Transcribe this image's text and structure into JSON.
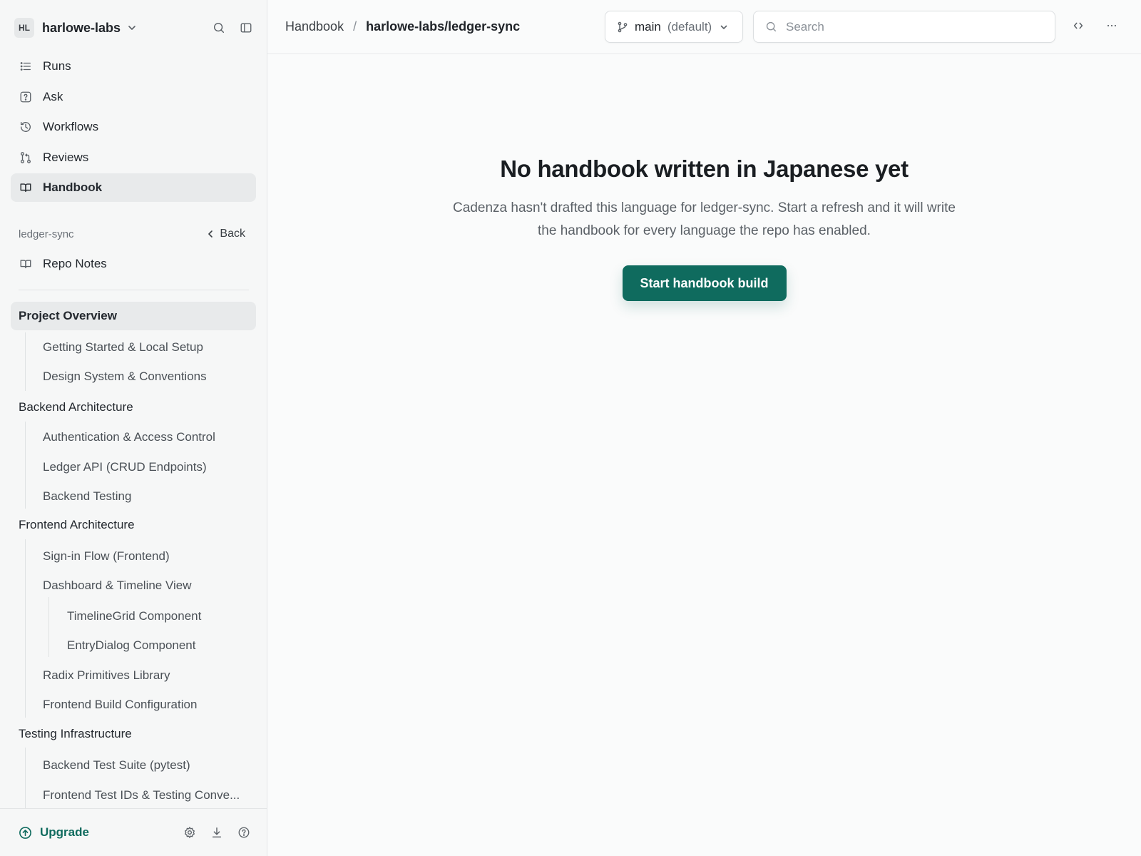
{
  "workspace": {
    "initials": "HL",
    "name": "harlowe-labs"
  },
  "nav": {
    "items": [
      {
        "label": "Runs",
        "icon": "list-icon"
      },
      {
        "label": "Ask",
        "icon": "question-icon"
      },
      {
        "label": "Workflows",
        "icon": "history-icon"
      },
      {
        "label": "Reviews",
        "icon": "pull-request-icon"
      },
      {
        "label": "Handbook",
        "icon": "book-icon",
        "active": true
      }
    ]
  },
  "repo": {
    "name": "ledger-sync",
    "back_label": "Back",
    "notes_label": "Repo Notes"
  },
  "toc": [
    {
      "label": "Project Overview",
      "level": 0,
      "active": true
    },
    {
      "label": "Getting Started & Local Setup",
      "level": 1
    },
    {
      "label": "Design System & Conventions",
      "level": 1
    },
    {
      "label": "Backend Architecture",
      "level": 0
    },
    {
      "label": "Authentication & Access Control",
      "level": 1
    },
    {
      "label": "Ledger API (CRUD Endpoints)",
      "level": 1
    },
    {
      "label": "Backend Testing",
      "level": 1
    },
    {
      "label": "Frontend Architecture",
      "level": 0
    },
    {
      "label": "Sign-in Flow (Frontend)",
      "level": 1
    },
    {
      "label": "Dashboard & Timeline View",
      "level": 1
    },
    {
      "label": "TimelineGrid Component",
      "level": 2
    },
    {
      "label": "EntryDialog Component",
      "level": 2
    },
    {
      "label": "Radix Primitives Library",
      "level": 1
    },
    {
      "label": "Frontend Build Configuration",
      "level": 1
    },
    {
      "label": "Testing Infrastructure",
      "level": 0
    },
    {
      "label": "Backend Test Suite (pytest)",
      "level": 1
    },
    {
      "label": "Frontend Test IDs & Testing Conve...",
      "level": 1
    }
  ],
  "footer": {
    "upgrade_label": "Upgrade"
  },
  "topbar": {
    "breadcrumb_root": "Handbook",
    "breadcrumb_sep": "/",
    "breadcrumb_current": "harlowe-labs/ledger-sync",
    "branch_name": "main",
    "branch_default": "(default)",
    "search_placeholder": "Search"
  },
  "empty_state": {
    "title": "No handbook written in Japanese yet",
    "description": "Cadenza hasn't drafted this language for ledger-sync. Start a refresh and it will write the handbook for every language the repo has enabled.",
    "button_label": "Start handbook build"
  },
  "colors": {
    "accent": "#0f6b5e",
    "active_bg": "#e8eaeb",
    "sidebar_bg": "#f6f7f7"
  }
}
